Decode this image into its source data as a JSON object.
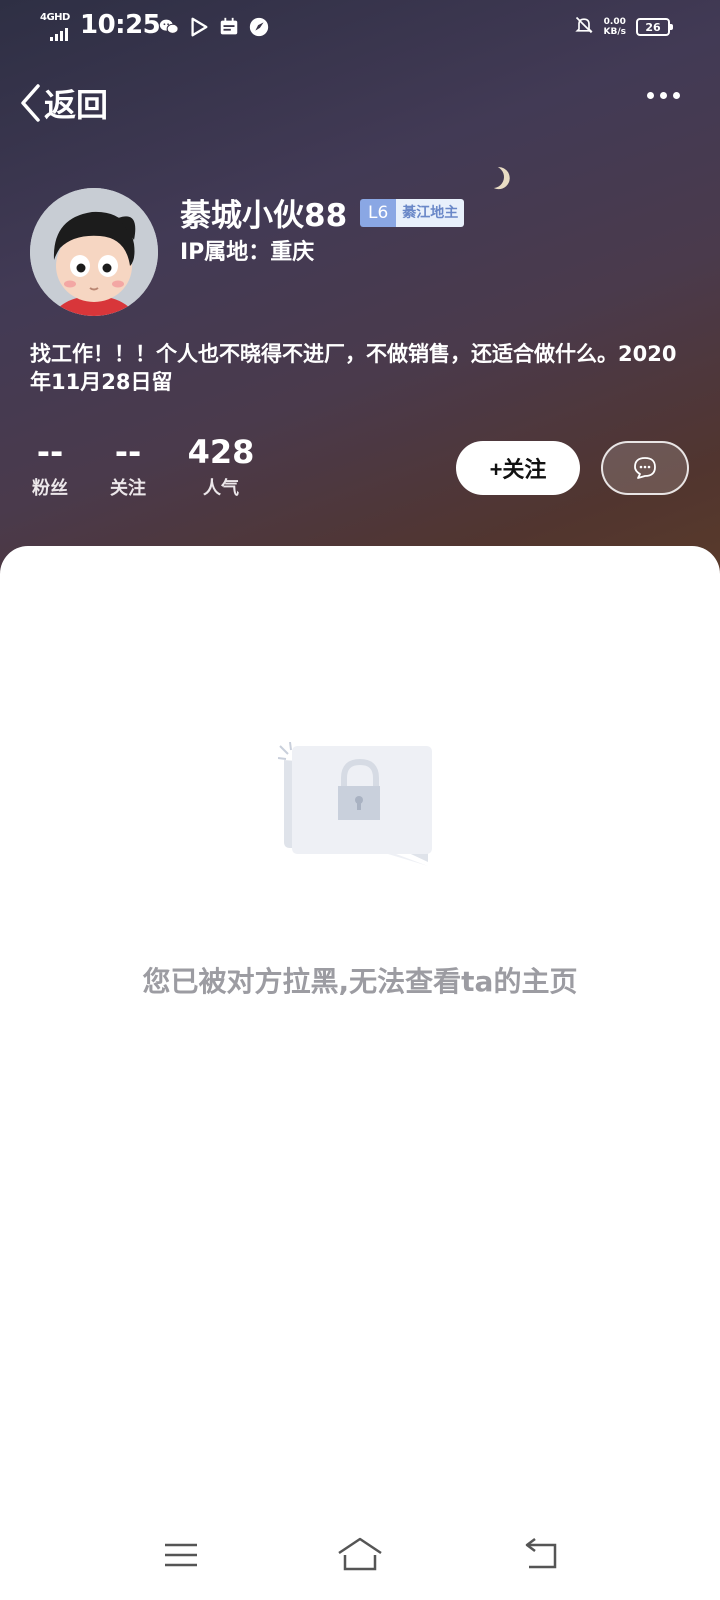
{
  "status_bar": {
    "network": "4GHD",
    "time": "10:25",
    "net_speed_value": "0.00",
    "net_speed_unit": "KB/s",
    "battery": "26"
  },
  "nav": {
    "back_label": "返回"
  },
  "profile": {
    "username": "綦城小伙88",
    "level": "L6",
    "tag": "綦江地主",
    "ip_location": "IP属地：重庆",
    "bio": "找工作！！！个人也不晓得不进厂，不做销售，还适合做什么。2020年11月28日留"
  },
  "stats": {
    "fans_value": "--",
    "fans_label": "粉丝",
    "following_value": "--",
    "following_label": "关注",
    "popularity_value": "428",
    "popularity_label": "人气"
  },
  "actions": {
    "follow_label": "+关注"
  },
  "content": {
    "blocked_message": "您已被对方拉黑,无法查看ta的主页"
  },
  "colors": {
    "level_badge": "#8aa7e4",
    "message_text": "#9c9ca2"
  }
}
